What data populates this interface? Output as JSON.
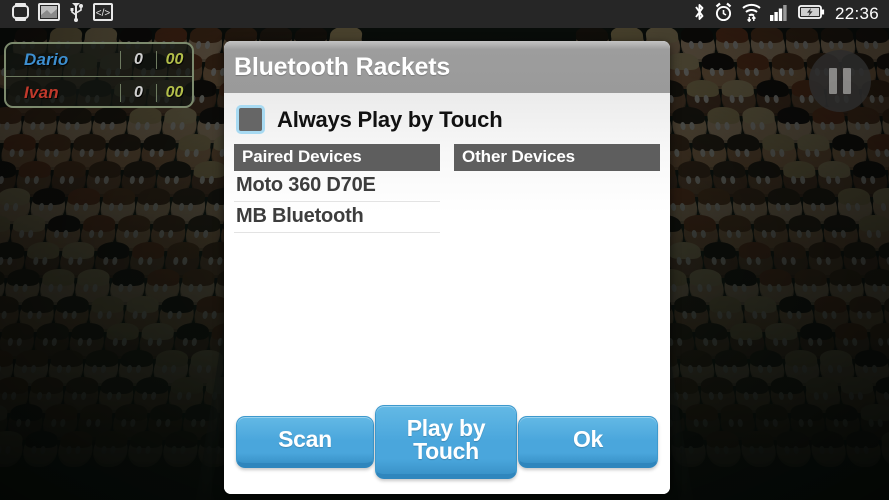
{
  "statusbar": {
    "left_icons": [
      {
        "name": "smartwatch-icon"
      },
      {
        "name": "screenshot-icon"
      },
      {
        "name": "usb-icon"
      },
      {
        "name": "developer-code-icon"
      }
    ],
    "right_icons": [
      {
        "name": "bluetooth-icon"
      },
      {
        "name": "alarm-clock-icon"
      },
      {
        "name": "wifi-icon"
      },
      {
        "name": "cellular-signal-icon"
      },
      {
        "name": "battery-charging-icon"
      }
    ],
    "clock": "22:36",
    "background_color": "#262626"
  },
  "scoreboard": {
    "rows": [
      {
        "name": "Dario",
        "games": "0",
        "points": "00",
        "color": "#3d8fd0"
      },
      {
        "name": "Ivan",
        "games": "0",
        "points": "00",
        "color": "#c0392b"
      }
    ]
  },
  "pause_button": {
    "name": "pause-button"
  },
  "dialog": {
    "title": "Bluetooth Rackets",
    "touch_option": {
      "label": "Always Play by Touch",
      "checked": false
    },
    "columns": [
      {
        "header": "Paired Devices",
        "devices": [
          "Moto 360 D70E",
          "MB Bluetooth"
        ]
      },
      {
        "header": "Other Devices",
        "devices": []
      }
    ],
    "buttons": {
      "scan": "Scan",
      "play_by_touch": "Play by\nTouch",
      "play_by_touch_line1": "Play by",
      "play_by_touch_line2": "Touch",
      "ok": "Ok"
    },
    "accent_color": "#4aa6dc",
    "header_color": "#9a9a9a",
    "column_header_color": "#5e5e5e"
  }
}
